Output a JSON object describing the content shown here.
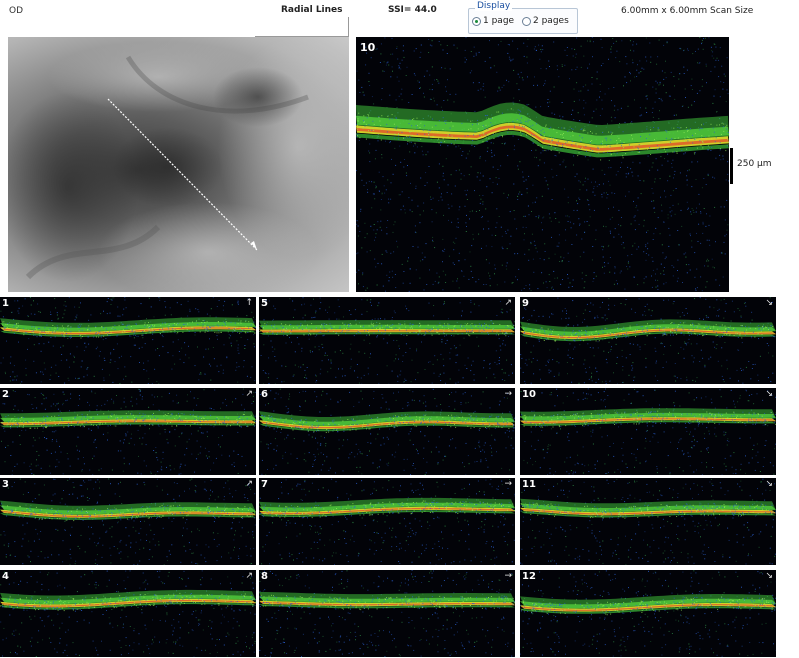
{
  "header": {
    "eye": "OD",
    "protocol": "Radial Lines",
    "ssi": "SSI= 44.0",
    "scan_size": "6.00mm x 6.00mm Scan Size"
  },
  "display": {
    "legend": "Display",
    "options": [
      "1 page",
      "2 pages"
    ],
    "selected": "1 page"
  },
  "large_scan": {
    "label": "10"
  },
  "scale": {
    "label": "250 µm"
  },
  "thumbnails": [
    {
      "label": "1",
      "arrow": "↑"
    },
    {
      "label": "2",
      "arrow": "↗"
    },
    {
      "label": "3",
      "arrow": "↗"
    },
    {
      "label": "4",
      "arrow": "↗"
    },
    {
      "label": "5",
      "arrow": "↗"
    },
    {
      "label": "6",
      "arrow": "→"
    },
    {
      "label": "7",
      "arrow": "→"
    },
    {
      "label": "8",
      "arrow": "→"
    },
    {
      "label": "9",
      "arrow": "↘"
    },
    {
      "label": "10",
      "arrow": "↘"
    },
    {
      "label": "11",
      "arrow": "↘"
    },
    {
      "label": "12",
      "arrow": "↘"
    }
  ],
  "colors": {
    "scan_background": "#020308",
    "retina_green": "#3fbf3a",
    "retina_yellow": "#e6e62e",
    "retina_red": "#e0502a",
    "noise_blue": "#2a5fd0",
    "scan_line": "#ffffff"
  }
}
